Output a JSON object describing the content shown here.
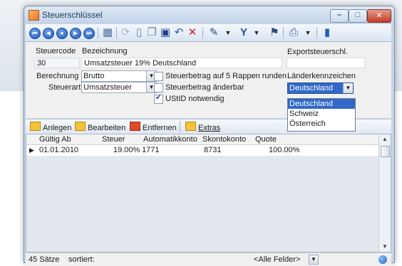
{
  "window": {
    "title": "Steuerschlüssel"
  },
  "titlebar_buttons": {
    "minimize": "–",
    "maximize": "□",
    "close": "✕"
  },
  "toolbar": {
    "nav": [
      "⏮",
      "◀",
      "●",
      "▶",
      "⏭"
    ],
    "icons": [
      "grid-icon",
      "refresh-icon",
      "new-icon",
      "copy-icon",
      "save-icon",
      "undo-icon",
      "delete-icon",
      "tools-icon",
      "filter-icon",
      "flag-icon",
      "print-icon",
      "exit-icon"
    ]
  },
  "form": {
    "steuercode_label": "Steuercode",
    "steuercode_value": "30",
    "bezeichnung_label": "Bezeichnung",
    "bezeichnung_value": "Umsatzsteuer 19% Deutschland",
    "exportsteuerschl_label": "Exportsteuerschl.",
    "exportsteuerschl_value": "",
    "berechnung_label": "Berechnung",
    "berechnung_value": "Brutto",
    "steuerart_label": "Steuerart",
    "steuerart_value": "Umsatzsteuer",
    "check_rappen_label": "Steuerbetrag auf 5 Rappen runden",
    "check_aenderbar_label": "Steuerbetrag änderbar",
    "check_ustid_label": "UStID notwendig",
    "laenderkennzeichen_label": "Länderkennzeichen",
    "laenderkennzeichen_value": "Deutschland",
    "laender_options": [
      "Deutschland",
      "Schweiz",
      "Österreich"
    ]
  },
  "actions": {
    "anlegen": "Anlegen",
    "bearbeiten": "Bearbeiten",
    "entfernen": "Entfernen",
    "extras": "Extras"
  },
  "grid": {
    "columns": [
      "Gültig Ab",
      "Steuer",
      "Automatikkonto",
      "Skontokonto",
      "Quote"
    ],
    "rows": [
      {
        "gueltig_ab": "01.01.2010",
        "steuer": "19.00%",
        "automatikkonto": "1771",
        "skontokonto": "8731",
        "quote": "100.00%"
      }
    ]
  },
  "status": {
    "count": "45 Sätze",
    "sort": "sortiert:",
    "field_filter": "<Alle Felder>"
  },
  "colors": {
    "accent": "#3069c8",
    "titlebar": "#c3d4e9"
  }
}
